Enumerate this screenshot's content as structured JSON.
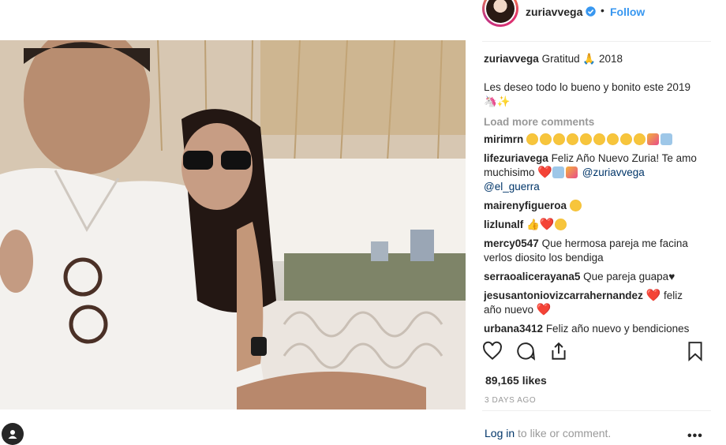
{
  "post": {
    "username": "zuriavvega",
    "separator": "•",
    "follow_label": "Follow",
    "caption": {
      "username": "zuriavvega",
      "text_before": "Gratitud",
      "text_after": "2018",
      "line2": "Les deseo todo lo bueno y bonito este 2019"
    },
    "load_more": "Load more comments",
    "comments": [
      {
        "user": "mirimrn",
        "text": ""
      },
      {
        "user": "lifezuriavega",
        "text": "Feliz Año Nuevo Zuria! Te amo muchisimo",
        "mention1": "@zuriavvega",
        "mention2": "@el_guerra"
      },
      {
        "user": "mairenyfigueroa",
        "text": ""
      },
      {
        "user": "lizlunalf",
        "text": ""
      },
      {
        "user": "mercy0547",
        "text": "Que hermosa pareja me facina verlos diosito los bendiga"
      },
      {
        "user": "serraoalicerayana5",
        "text": "Que pareja guapa♥"
      },
      {
        "user": "jesusantoniovizcarrahernandez",
        "text": "feliz",
        "text2": "año nuevo"
      },
      {
        "user": "urbana3412",
        "text": "Feliz año nuevo y bendiciones"
      }
    ],
    "likes": "89,165 likes",
    "date": "3 DAYS AGO",
    "login_link": "Log in",
    "login_rest": "to like or comment.",
    "more": "•••"
  },
  "icons": [
    "heart-icon",
    "comment-icon",
    "share-icon",
    "bookmark-icon",
    "user-tag-icon",
    "verified-badge-icon",
    "more-options-icon"
  ],
  "colors": {
    "accent": "#3897f0",
    "link": "#003569",
    "muted": "#999999",
    "heart": "#e0245e"
  }
}
